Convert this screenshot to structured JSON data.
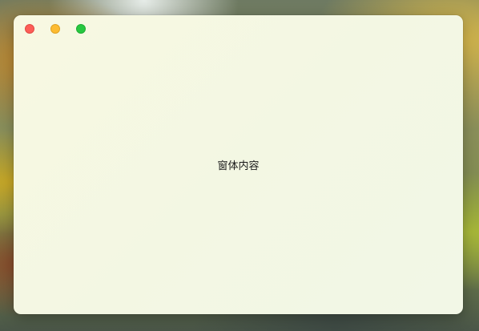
{
  "window": {
    "content_text": "窗体内容",
    "controls": {
      "close_icon": "close-icon",
      "minimize_icon": "minimize-icon",
      "maximize_icon": "maximize-icon",
      "close_color": "#fd5d57",
      "minimize_color": "#fdbb30",
      "maximize_color": "#27c840"
    },
    "background_color": "#f4f7e4"
  }
}
